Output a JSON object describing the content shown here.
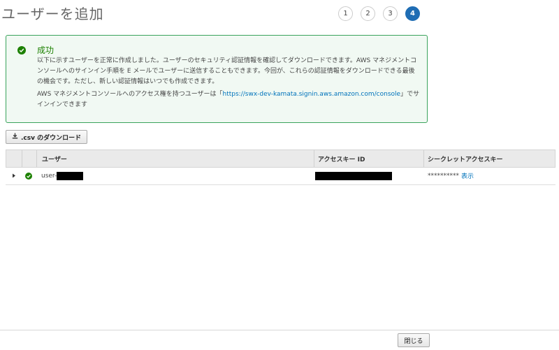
{
  "page": {
    "title": "ユーザーを追加"
  },
  "steps": [
    {
      "label": "1"
    },
    {
      "label": "2"
    },
    {
      "label": "3"
    },
    {
      "label": "4",
      "active": true
    }
  ],
  "success": {
    "title": "成功",
    "message": "以下に示すユーザーを正常に作成しました。ユーザーのセキュリティ認証情報を確認してダウンロードできます。AWS マネジメントコンソールへのサインイン手順を E メールでユーザーに送信することもできます。今回が、これらの認証情報をダウンロードできる最後の機会です。ただし、新しい認証情報はいつでも作成できます。",
    "signin_prefix": "AWS マネジメントコンソールへのアクセス権を持つユーザーは「",
    "signin_url": "https://swx-dev-kamata.signin.aws.amazon.com/console",
    "signin_suffix": "」でサインインできます",
    "color": "#1d8102"
  },
  "toolbar": {
    "csv_download_label": ".csv のダウンロード"
  },
  "table": {
    "headers": [
      "ユーザー",
      "アクセスキー ID",
      "シークレットアクセスキー"
    ],
    "rows": [
      {
        "user_prefix": "user-",
        "secret_masked": "**********",
        "secret_reveal_label": "表示"
      }
    ]
  },
  "footer": {
    "close_label": "閉じる"
  },
  "colors": {
    "accent": "#1f6db4",
    "link": "#0073bb",
    "success": "#1d8102"
  }
}
